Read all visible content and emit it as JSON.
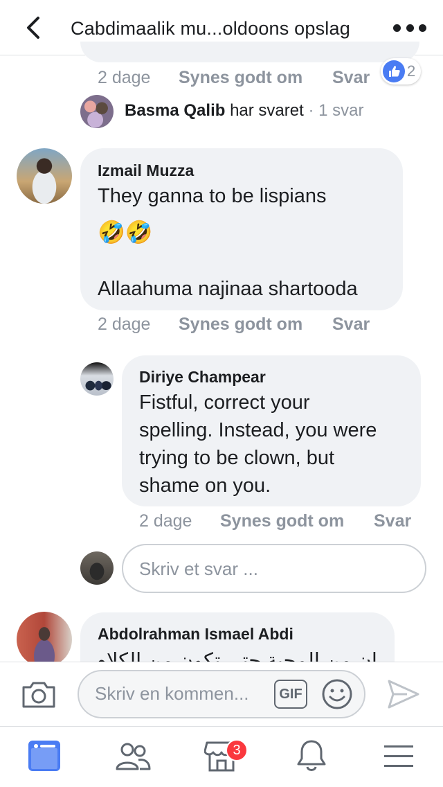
{
  "header": {
    "title": "Cabdimaalik mu...oldoons opslag"
  },
  "prev_comment": {
    "time": "2 dage",
    "like_label": "Synes godt om",
    "reply_label": "Svar",
    "reaction_count": "2"
  },
  "reply_summary": {
    "name": "Basma Qalib",
    "action": "har svaret",
    "separator": "·",
    "count": "1 svar"
  },
  "comments": [
    {
      "author": "Izmail Muzza",
      "line1": "They ganna to be lispians",
      "emoji": "🤣🤣",
      "line2": "Allaahuma najinaa shartooda",
      "time": "2 dage",
      "like_label": "Synes godt om",
      "reply_label": "Svar"
    }
  ],
  "reply": {
    "author": "Diriye Champear",
    "lines": [
      "Fistful, correct your",
      "spelling. Instead, you were",
      "trying to be clown, but",
      "shame on you."
    ],
    "time": "2 dage",
    "like_label": "Synes godt om",
    "reply_label": "Svar"
  },
  "reply_input": {
    "placeholder": "Skriv et svar ..."
  },
  "next_comment": {
    "author": "Abdolrahman Ismael Abdi",
    "partial_text": "إن من المحبة حتى تكون من الكلام"
  },
  "composer": {
    "placeholder": "Skriv en kommen...",
    "gif_label": "GIF"
  },
  "tabbar": {
    "marketplace_badge": "3"
  },
  "colors": {
    "accent": "#4a7cf3",
    "text": "#1c1e21",
    "muted": "#8d949e",
    "bubble": "#f0f2f5",
    "badge": "#fa383e"
  }
}
